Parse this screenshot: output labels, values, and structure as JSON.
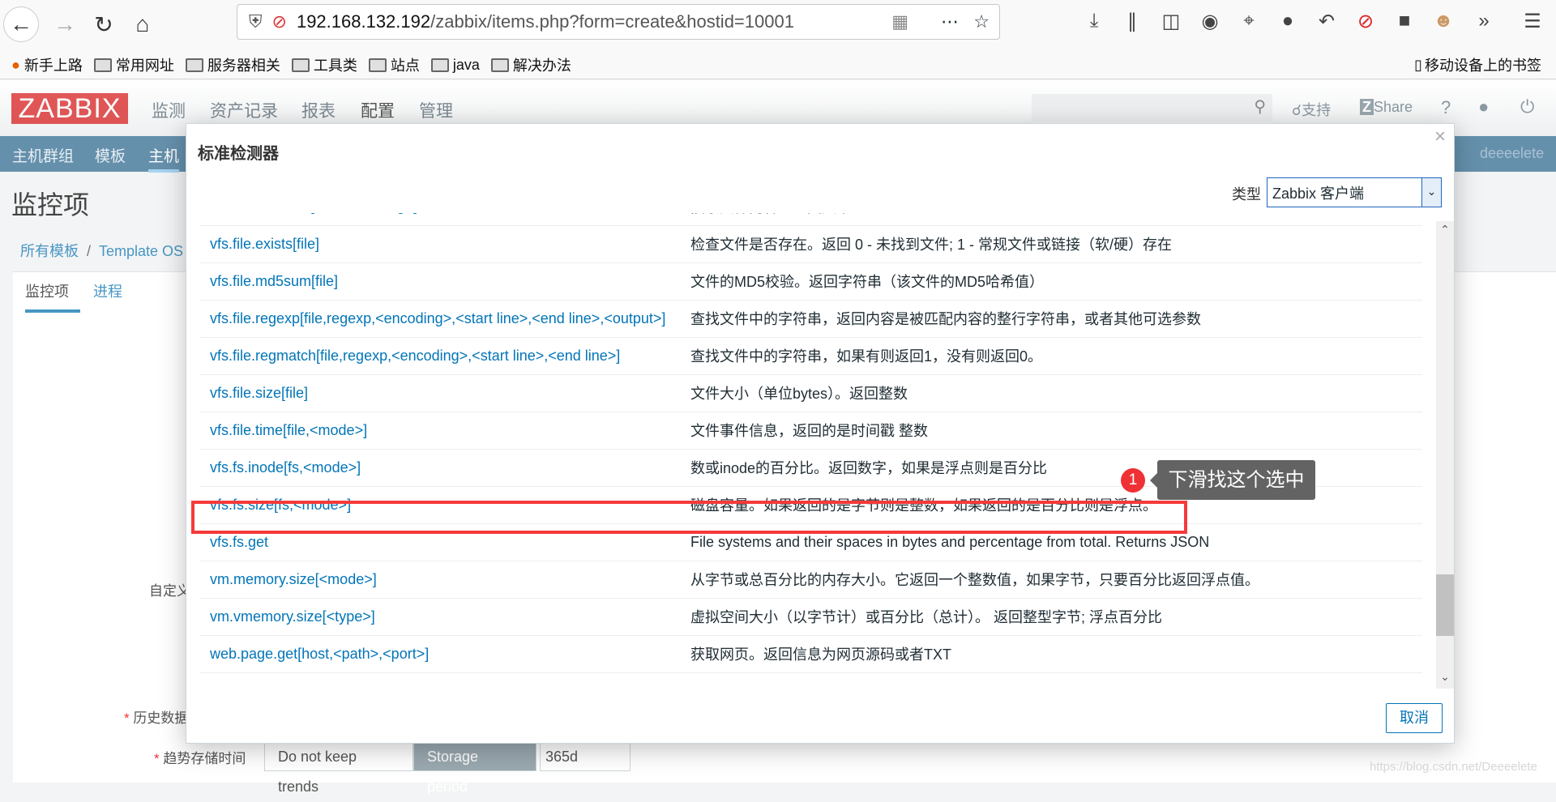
{
  "browser": {
    "url_host": "192.168.132.192",
    "url_path": "/zabbix/items.php?form=create&hostid=10001",
    "bookmarks": [
      "新手上路",
      "常用网址",
      "服务器相关",
      "工具类",
      "站点",
      "java",
      "解决办法"
    ],
    "mobile_bookmarks": "移动设备上的书签"
  },
  "zabbix": {
    "logo": "ZABBIX",
    "top_nav": [
      "监测",
      "资产记录",
      "报表",
      "配置",
      "管理"
    ],
    "support": "支持",
    "share": "Share",
    "help": "?",
    "sub_nav": [
      "主机群组",
      "模板",
      "主机"
    ],
    "user": "deeeelete",
    "page_title": "监控项",
    "breadcrumb": [
      "所有模板",
      "Template OS"
    ],
    "tabs": [
      "监控项",
      "进程"
    ],
    "form": {
      "custom_label": "自定义",
      "history_label": "历史数据",
      "trends_label": "趋势存储时间",
      "trend_options": [
        "Do not keep trends",
        "Storage period"
      ],
      "trend_value": "365d"
    }
  },
  "modal": {
    "title": "标准检测器",
    "type_label": "类型",
    "type_value": "Zabbix 客户端",
    "cancel": "取消",
    "items": [
      {
        "key": "vfs.file.contents[file,<encoding>]",
        "desc": "搜索文件内容。返回文本"
      },
      {
        "key": "vfs.file.exists[file]",
        "desc": "检查文件是否存在。返回 0 - 未找到文件; 1 - 常规文件或链接（软/硬）存在"
      },
      {
        "key": "vfs.file.md5sum[file]",
        "desc": "文件的MD5校验。返回字符串（该文件的MD5哈希值）"
      },
      {
        "key": "vfs.file.regexp[file,regexp,<encoding>,<start line>,<end line>,<output>]",
        "desc": "查找文件中的字符串，返回内容是被匹配内容的整行字符串，或者其他可选参数"
      },
      {
        "key": "vfs.file.regmatch[file,regexp,<encoding>,<start line>,<end line>]",
        "desc": "查找文件中的字符串，如果有则返回1，没有则返回0。"
      },
      {
        "key": "vfs.file.size[file]",
        "desc": "文件大小（单位bytes）。返回整数"
      },
      {
        "key": "vfs.file.time[file,<mode>]",
        "desc": "文件事件信息，返回的是时间戳 整数"
      },
      {
        "key": "vfs.fs.inode[fs,<mode>]",
        "desc": "数或inode的百分比。返回数字，如果是浮点则是百分比"
      },
      {
        "key": "vfs.fs.size[fs,<mode>]",
        "desc": "磁盘容量。如果返回的是字节则是整数，如果返回的是百分比则是浮点。"
      },
      {
        "key": "vfs.fs.get",
        "desc": "File systems and their spaces in bytes and percentage from total. Returns JSON"
      },
      {
        "key": "vm.memory.size[<mode>]",
        "desc": "从字节或总百分比的内存大小。它返回一个整数值，如果字节，只要百分比返回浮点值。"
      },
      {
        "key": "vm.vmemory.size[<type>]",
        "desc": "虚拟空间大小（以字节计）或百分比（总计）。 返回整型字节; 浮点百分比"
      },
      {
        "key": "web.page.get[host,<path>,<port>]",
        "desc": "获取网页。返回信息为网页源码或者TXT"
      }
    ]
  },
  "annotation": {
    "number": "1",
    "text": "下滑找这个选中",
    "color": "#f53a3a"
  },
  "watermark": "https://blog.csdn.net/Deeeelete"
}
